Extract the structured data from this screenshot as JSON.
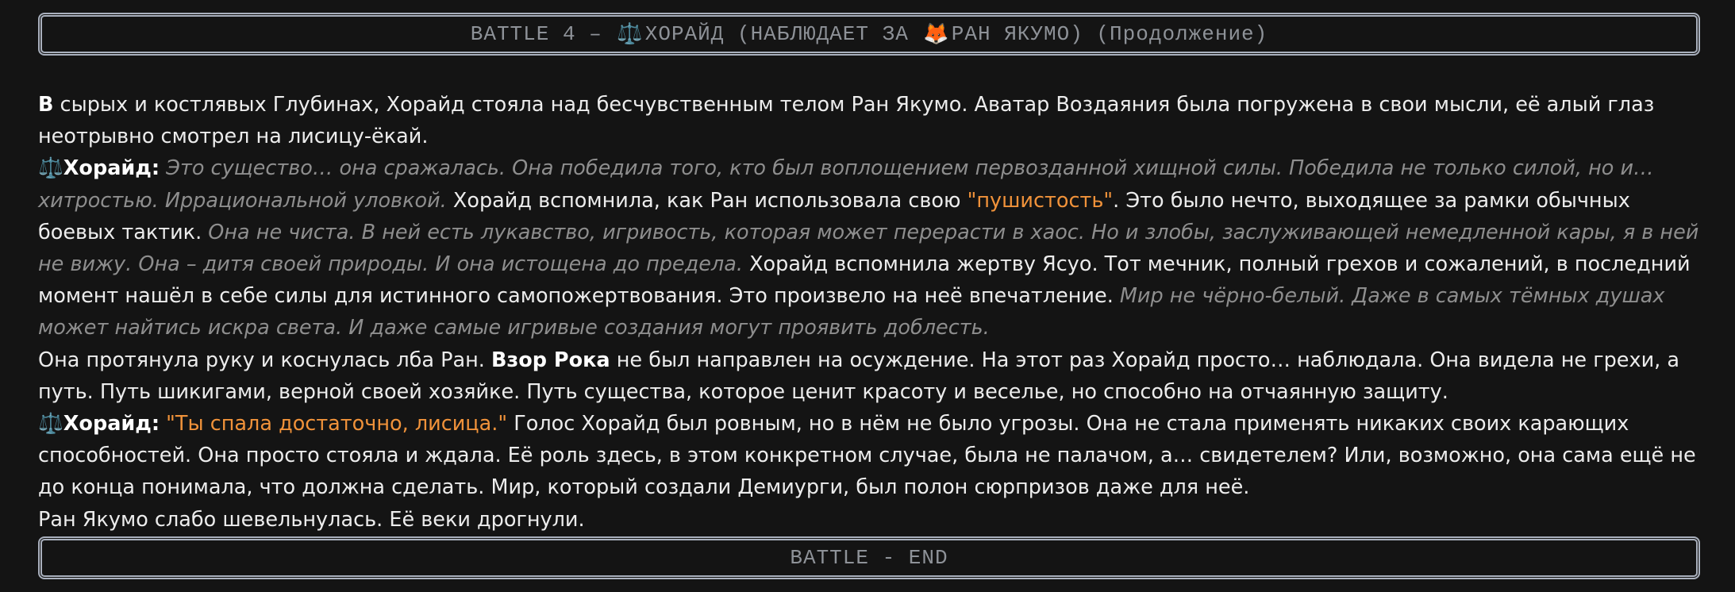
{
  "header": {
    "prefix": "BATTLE 4 –",
    "scale_emoji": "⚖️",
    "name": "ХОРАЙД (НАБЛЮДАЕТ ЗА",
    "fox_emoji": "🦊",
    "target": "РАН ЯКУМО) (Продолжение)"
  },
  "footer": {
    "label": "BATTLE - END"
  },
  "story": {
    "p1": {
      "bold_start": "В",
      "text": " сырых и костлявых Глубинах, Хорайд стояла над бесчувственным телом Ран Якумо. Аватар Воздаяния была погружена в свои мысли, её алый глаз неотрывно смотрел на лисицу-ёкай."
    },
    "p2": {
      "icon": "⚖️",
      "speaker": "Хорайд:",
      "t1": " Это существо… она сражалась. Она победила того, кто был воплощением первозданной хищной силы. Победила не только силой, но и… хитростью. Иррациональной уловкой.",
      "n1": " Хорайд вспомнила, как Ран использовала свою ",
      "q1": "\"пушистость\"",
      "n2": ". Это было нечто, выходящее за рамки обычных боевых тактик.",
      "t2": " Она не чиста. В ней есть лукавство, игривость, которая может перерасти в хаос. Но и злобы, заслуживающей немедленной кары, я в ней не вижу. Она – дитя своей природы. И она истощена до предела.",
      "n3": " Хорайд вспомнила жертву Ясуо. Тот мечник, полный грехов и сожалений, в последний момент нашёл в себе силы для истинного самопожертвования. Это произвело на неё впечатление.",
      "t3": " Мир не чёрно-белый. Даже в самых тёмных душах может найтись искра света. И даже самые игривые создания могут проявить доблесть."
    },
    "p3": {
      "a": "Она протянула руку и коснулась лба Ран. ",
      "bold": "Взор Рока",
      "b": " не был направлен на осуждение. На этот раз Хорайд просто… наблюдала. Она видела не грехи, а путь. Путь шикигами, верной своей хозяйке. Путь существа, которое ценит красоту и веселье, но способно на отчаянную защиту."
    },
    "p4": {
      "icon": "⚖️",
      "speaker": "Хорайд:",
      "quote": " \"Ты спала достаточно, лисица.\"",
      "text": " Голос Хорайд был ровным, но в нём не было угрозы. Она не стала применять никаких своих карающих способностей. Она просто стояла и ждала. Её роль здесь, в этом конкретном случае, была не палачом, а… свидетелем? Или, возможно, она сама ещё не до конца понимала, что должна сделать. Мир, который создали Демиурги, был полон сюрпризов даже для неё."
    },
    "p5": {
      "text": "Ран Якумо слабо шевельнулась. Её веки дрогнули."
    }
  }
}
